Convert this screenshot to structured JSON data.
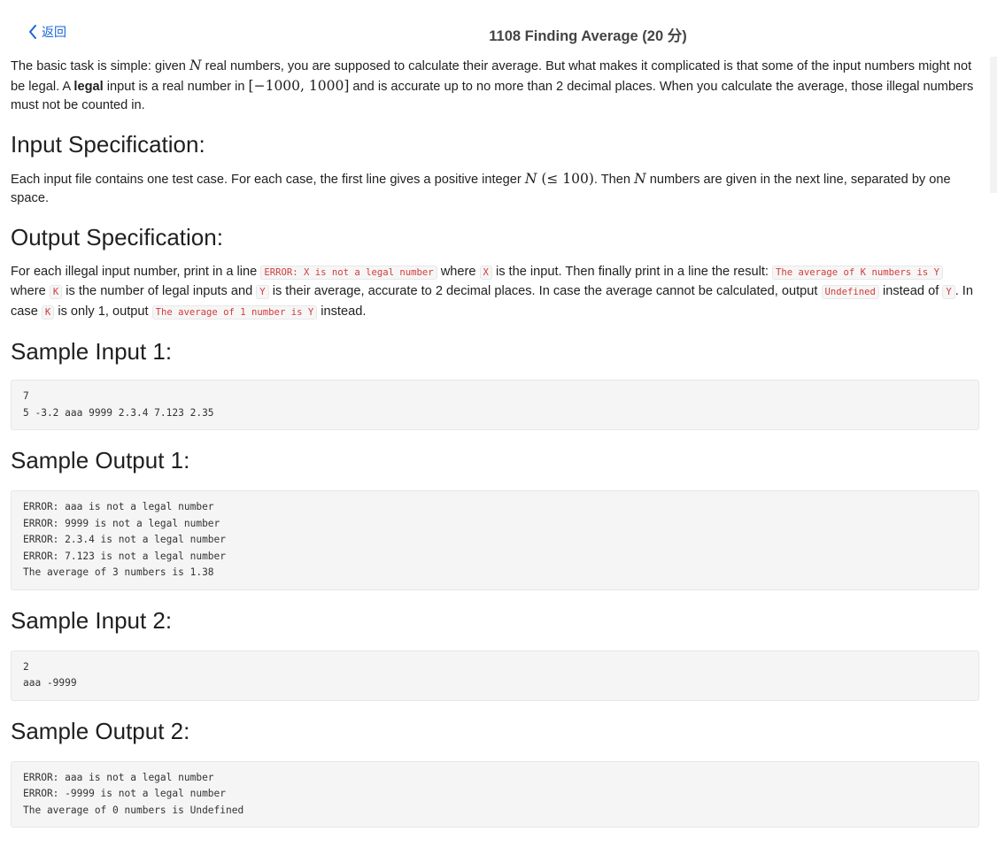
{
  "header": {
    "back_label": "返回",
    "title": "1108 Finding Average (20 分)"
  },
  "intro": {
    "t1": "The basic task is simple: given ",
    "N": "N",
    "t2": " real numbers, you are supposed to calculate their average. But what makes it complicated is that some of the input numbers might not be legal. A ",
    "legal": "legal",
    "t3": " input is a real number in ",
    "range": "[−1000, 1000]",
    "t4": " and is accurate up to no more than 2 decimal places. When you calculate the average, those il­legal numbers must not be counted in."
  },
  "input_spec": {
    "heading": "Input Specification:",
    "t1": "Each input file contains one test case. For each case, the first line gives a positive integer ",
    "N": "N",
    "cond": " (≤ 100)",
    "t2": ". Then ",
    "N2": "N",
    "t3": " numbers are given in the next line, separated by one space."
  },
  "output_spec": {
    "heading": "Output Specification:",
    "t1": "For each illegal input number, print in a line ",
    "c1": "ERROR: X is not a legal number",
    "t2": " where ",
    "c2": "X",
    "t3": " is the input. Then finally print in a line the result: ",
    "c3": "The average of K num­bers is Y",
    "t4": " where ",
    "c4": "K",
    "t5": " is the number of legal inputs and ",
    "c5": "Y",
    "t6": " is their average, accurate to 2 decimal places. In case the average cannot be calculated, output ",
    "c6": "Undefined",
    "t7": " instead of ",
    "c7": "Y",
    "t8": ". In case ",
    "c8": "K",
    "t9": " is only 1, output ",
    "c9": "The average of 1 number is Y",
    "t10": " instead."
  },
  "samples": [
    {
      "heading": "Sample Input 1:",
      "code": "7\n5 -3.2 aaa 9999 2.3.4 7.123 2.35"
    },
    {
      "heading": "Sample Output 1:",
      "code": "ERROR: aaa is not a legal number\nERROR: 9999 is not a legal number\nERROR: 2.3.4 is not a legal number\nERROR: 7.123 is not a legal number\nThe average of 3 numbers is 1.38"
    },
    {
      "heading": "Sample Input 2:",
      "code": "2\naaa -9999"
    },
    {
      "heading": "Sample Output 2:",
      "code": "ERROR: aaa is not a legal number\nERROR: -9999 is not a legal number\nThe average of 0 numbers is Undefined"
    }
  ],
  "icons": {
    "back": "chevron-left-icon"
  },
  "colors": {
    "link": "#1a66d6",
    "code_text": "#d23c3c",
    "code_bg": "#f5f5f5"
  }
}
